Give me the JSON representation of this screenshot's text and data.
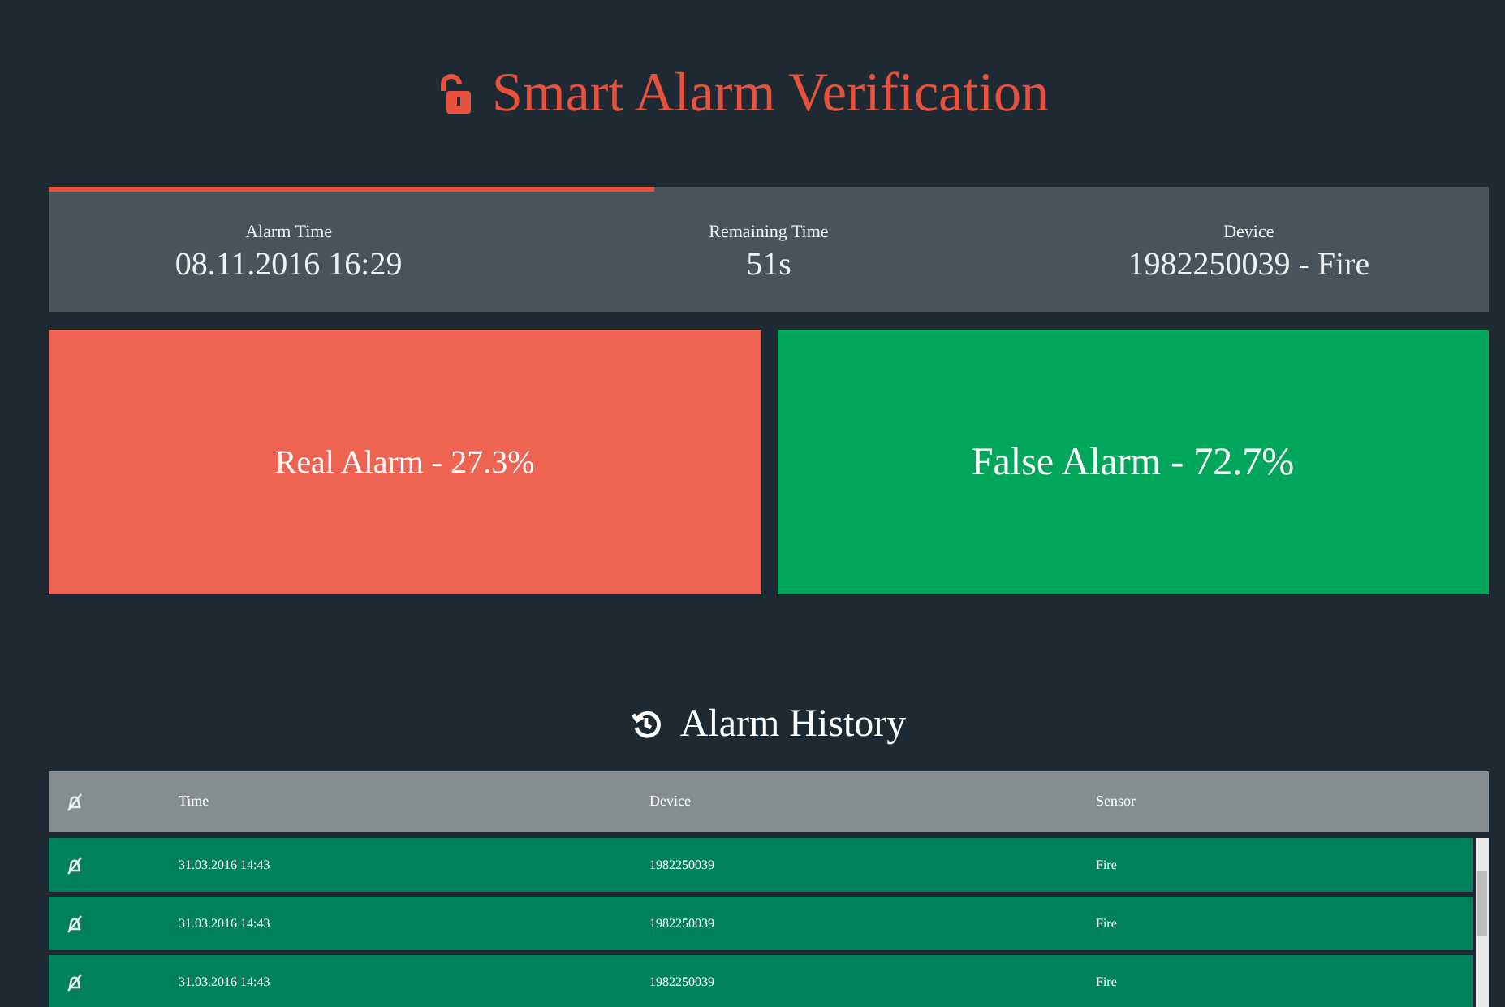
{
  "title": "Smart Alarm Verification",
  "countdown": {
    "level": 0.42
  },
  "info": [
    {
      "label": "Alarm Time",
      "value": "08.11.2016 16:29"
    },
    {
      "label": "Remaining Time",
      "value": "51s"
    },
    {
      "label": "Device",
      "value": "1982250039 - Fire"
    }
  ],
  "verdicts": [
    {
      "kind": "real",
      "label": "Real Alarm - 27.3%",
      "color": "#ee6352"
    },
    {
      "kind": "false",
      "label": "False Alarm - 72.7%",
      "color": "#00a65a"
    }
  ],
  "history": {
    "title": "Alarm History",
    "columns": [
      "Time",
      "Device",
      "Sensor"
    ],
    "rows": [
      {
        "cells": [
          "31.03.2016 14:43",
          "1982250039",
          "Fire"
        ]
      },
      {
        "cells": [
          "31.03.2016 14:43",
          "1982250039",
          "Fire"
        ]
      },
      {
        "cells": [
          "31.03.2016 14:43",
          "1982250039",
          "Fire"
        ]
      }
    ]
  }
}
